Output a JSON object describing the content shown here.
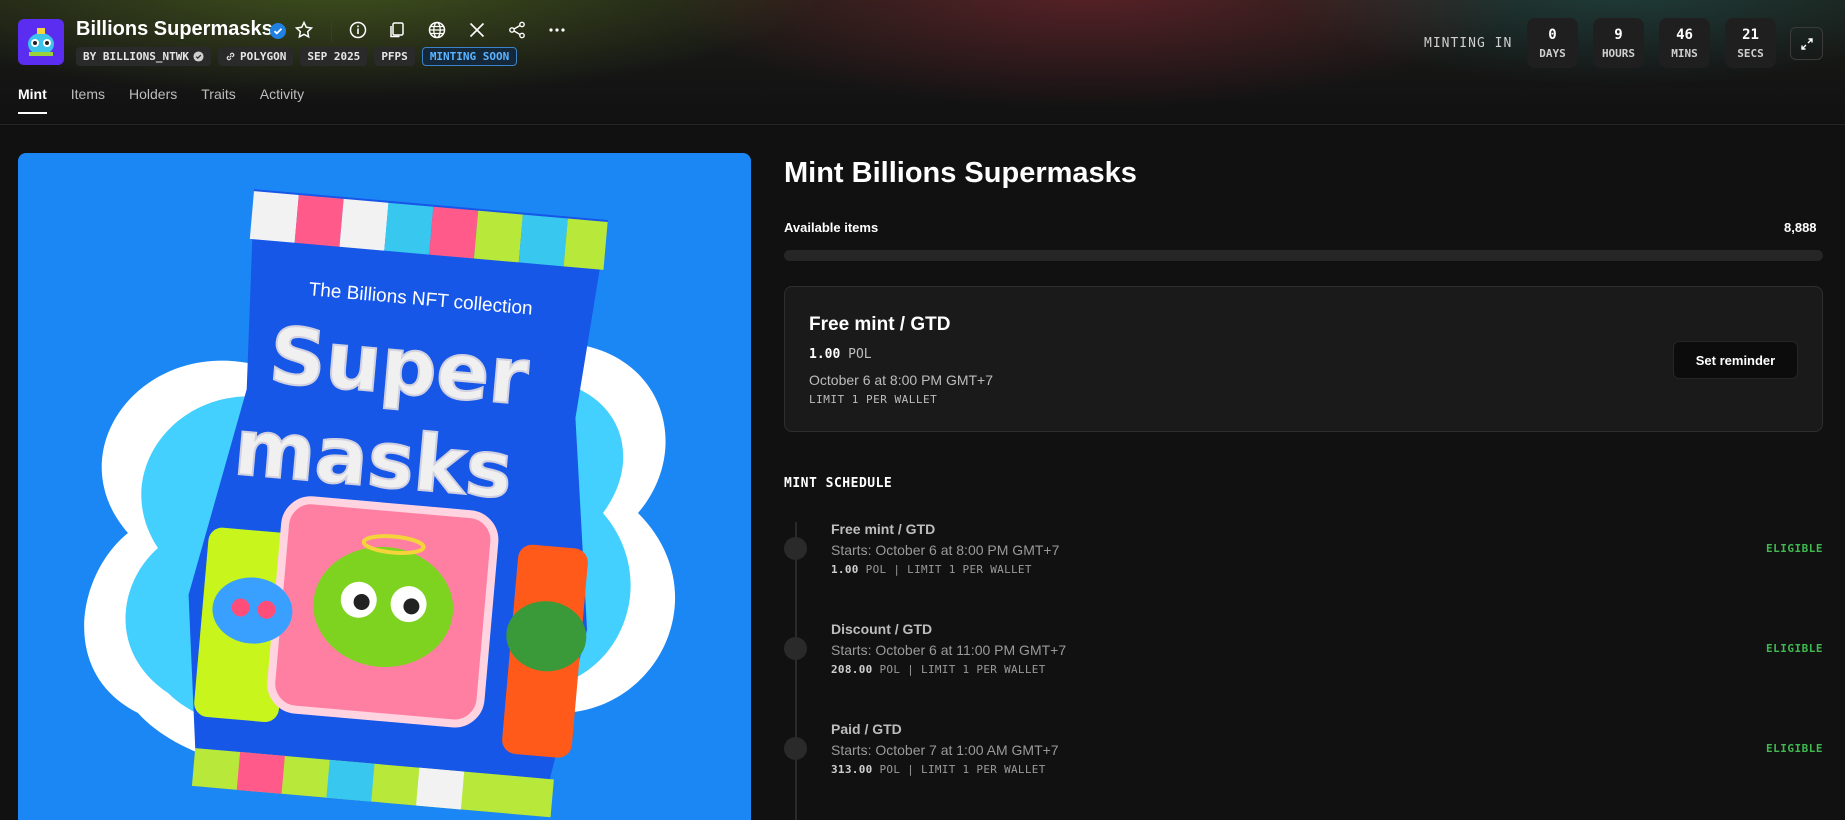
{
  "collection": {
    "title": "Billions Supermasks",
    "tags": [
      "BY BILLIONS_NTWK",
      "POLYGON",
      "SEP 2025",
      "PFPS",
      "MINTING SOON"
    ]
  },
  "header_icons": [
    "verified-icon",
    "star-icon",
    "info-icon",
    "copy-icon",
    "globe-icon",
    "x-icon",
    "share-icon",
    "more-icon",
    "expand-icon"
  ],
  "tabs": [
    "Mint",
    "Items",
    "Holders",
    "Traits",
    "Activity"
  ],
  "countdown": {
    "label": "MINTING IN",
    "units": [
      {
        "value": "0",
        "label": "DAYS"
      },
      {
        "value": "9",
        "label": "HOURS"
      },
      {
        "value": "46",
        "label": "MINS"
      },
      {
        "value": "21",
        "label": "SECS"
      }
    ]
  },
  "artwork": {
    "tagline": "The Billions NFT collection",
    "word1": "Super",
    "word2": "masks"
  },
  "mint": {
    "heading": "Mint Billions Supermasks",
    "available_label": "Available items",
    "available_value": "8,888",
    "progress": 0,
    "current": {
      "title": "Free mint / GTD",
      "price": "1.00",
      "currency": "POL",
      "date": "October 6 at 8:00 PM GMT+7",
      "limit": "LIMIT 1 PER WALLET",
      "button": "Set reminder"
    }
  },
  "schedule": {
    "heading": "MINT SCHEDULE",
    "phases": [
      {
        "title": "Free mint / GTD",
        "starts": "Starts: October 6 at 8:00 PM GMT+7",
        "price": "1.00",
        "detail": "POL | LIMIT 1 PER WALLET",
        "status": "ELIGIBLE"
      },
      {
        "title": "Discount / GTD",
        "starts": "Starts: October 6 at 11:00 PM GMT+7",
        "price": "208.00",
        "detail": "POL | LIMIT 1 PER WALLET",
        "status": "ELIGIBLE"
      },
      {
        "title": "Paid / GTD",
        "starts": "Starts: October 7 at 1:00 AM GMT+7",
        "price": "313.00",
        "detail": "POL | LIMIT 1 PER WALLET",
        "status": "ELIGIBLE"
      }
    ]
  },
  "colors": {
    "accent_blue": "#2081e2",
    "eligible_green": "#3fb950",
    "soon_blue": "#5ab4ff"
  }
}
